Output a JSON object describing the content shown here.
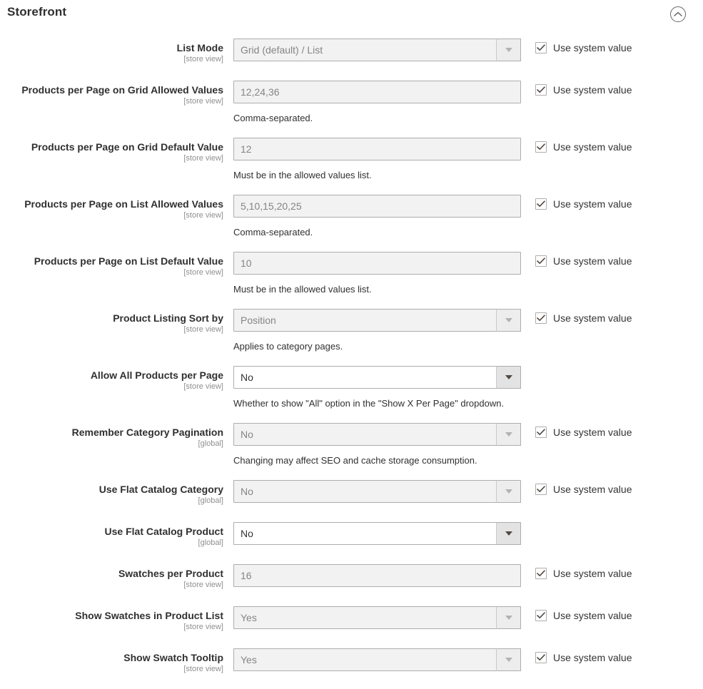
{
  "section": {
    "title": "Storefront",
    "collapse_icon": "chevron-up-circle-icon",
    "collapsed": false
  },
  "common": {
    "use_system_value_label": "Use system value",
    "scope_store_view": "[store view]",
    "scope_global": "[global]",
    "dropdown_arrow_icon": "chevron-down-icon",
    "checkbox_icon": "checkmark-icon"
  },
  "colors": {
    "page_background": "#ffffff",
    "label_text": "#303030",
    "scope_text": "#8f8f8f",
    "disabled_field_background": "#f2f2f2",
    "disabled_field_text": "#858585",
    "field_border": "#adadad",
    "active_field_background": "#ffffff",
    "active_field_text": "#333333",
    "active_arrow_background": "#e3e3e3",
    "note_text": "#303030"
  },
  "fields": [
    {
      "id": "list-mode",
      "label": "List Mode",
      "scope": "[store view]",
      "type": "select",
      "value": "Grid (default) / List",
      "disabled": true,
      "note": "",
      "use_system_value": true
    },
    {
      "id": "products-per-page-grid-allowed",
      "label": "Products per Page on Grid Allowed Values",
      "scope": "[store view]",
      "type": "text",
      "value": "12,24,36",
      "disabled": true,
      "note": "Comma-separated.",
      "use_system_value": true
    },
    {
      "id": "products-per-page-grid-default",
      "label": "Products per Page on Grid Default Value",
      "scope": "[store view]",
      "type": "text",
      "value": "12",
      "disabled": true,
      "note": "Must be in the allowed values list.",
      "use_system_value": true
    },
    {
      "id": "products-per-page-list-allowed",
      "label": "Products per Page on List Allowed Values",
      "scope": "[store view]",
      "type": "text",
      "value": "5,10,15,20,25",
      "disabled": true,
      "note": "Comma-separated.",
      "use_system_value": true
    },
    {
      "id": "products-per-page-list-default",
      "label": "Products per Page on List Default Value",
      "scope": "[store view]",
      "type": "text",
      "value": "10",
      "disabled": true,
      "note": "Must be in the allowed values list.",
      "use_system_value": true
    },
    {
      "id": "product-listing-sort-by",
      "label": "Product Listing Sort by",
      "scope": "[store view]",
      "type": "select",
      "value": "Position",
      "disabled": true,
      "note": "Applies to category pages.",
      "use_system_value": true
    },
    {
      "id": "allow-all-products-per-page",
      "label": "Allow All Products per Page",
      "scope": "[store view]",
      "type": "select",
      "value": "No",
      "disabled": false,
      "note": "Whether to show \"All\" option in the \"Show X Per Page\" dropdown.",
      "use_system_value": null
    },
    {
      "id": "remember-category-pagination",
      "label": "Remember Category Pagination",
      "scope": "[global]",
      "type": "select",
      "value": "No",
      "disabled": true,
      "note": "Changing may affect SEO and cache storage consumption.",
      "use_system_value": true
    },
    {
      "id": "use-flat-catalog-category",
      "label": "Use Flat Catalog Category",
      "scope": "[global]",
      "type": "select",
      "value": "No",
      "disabled": true,
      "note": "",
      "use_system_value": true
    },
    {
      "id": "use-flat-catalog-product",
      "label": "Use Flat Catalog Product",
      "scope": "[global]",
      "type": "select",
      "value": "No",
      "disabled": false,
      "note": "",
      "use_system_value": null
    },
    {
      "id": "swatches-per-product",
      "label": "Swatches per Product",
      "scope": "[store view]",
      "type": "text",
      "value": "16",
      "disabled": true,
      "note": "",
      "use_system_value": true
    },
    {
      "id": "show-swatches-in-product-list",
      "label": "Show Swatches in Product List",
      "scope": "[store view]",
      "type": "select",
      "value": "Yes",
      "disabled": true,
      "note": "",
      "use_system_value": true
    },
    {
      "id": "show-swatch-tooltip",
      "label": "Show Swatch Tooltip",
      "scope": "[store view]",
      "type": "select",
      "value": "Yes",
      "disabled": true,
      "note": "",
      "use_system_value": true
    }
  ]
}
